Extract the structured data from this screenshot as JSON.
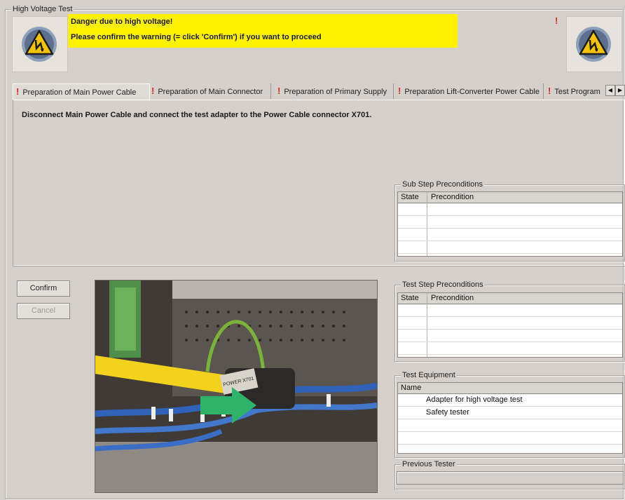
{
  "window": {
    "title": "High Voltage Test"
  },
  "banner": {
    "line1": "Danger due to high voltage!",
    "line2": "Please confirm the warning (= click 'Confirm') if you want to proceed",
    "color": "#fff200"
  },
  "icons": {
    "warning": "high-voltage-warning-icon",
    "exclamation": "!"
  },
  "tabs": [
    {
      "label": "Preparation of Main Power Cable",
      "active": true
    },
    {
      "label": "Preparation of Main Connector",
      "active": false
    },
    {
      "label": "Preparation of Primary Supply",
      "active": false
    },
    {
      "label": "Preparation Lift-Converter Power Cable",
      "active": false
    },
    {
      "label": "Test Program",
      "active": false
    }
  ],
  "instruction": "Disconnect Main Power Cable and connect the test adapter to the Power Cable connector X701.",
  "sub_step_preconditions": {
    "title": "Sub Step Preconditions",
    "columns": [
      "State",
      "Precondition"
    ],
    "rows": []
  },
  "buttons": {
    "confirm": "Confirm",
    "cancel": "Cancel",
    "cancel_enabled": false
  },
  "photo": {
    "description_icon": "photo-of-cable-connector",
    "label_text": "POWER X701",
    "arrow_color": "#2fb36a"
  },
  "test_step_preconditions": {
    "title": "Test Step Preconditions",
    "columns": [
      "State",
      "Precondition"
    ],
    "rows": []
  },
  "test_equipment": {
    "title": "Test Equipment",
    "columns": [
      "Name"
    ],
    "rows": [
      "Adapter for high voltage test",
      "Safety tester"
    ]
  },
  "previous_tester": {
    "title": "Previous Tester",
    "value": ""
  }
}
